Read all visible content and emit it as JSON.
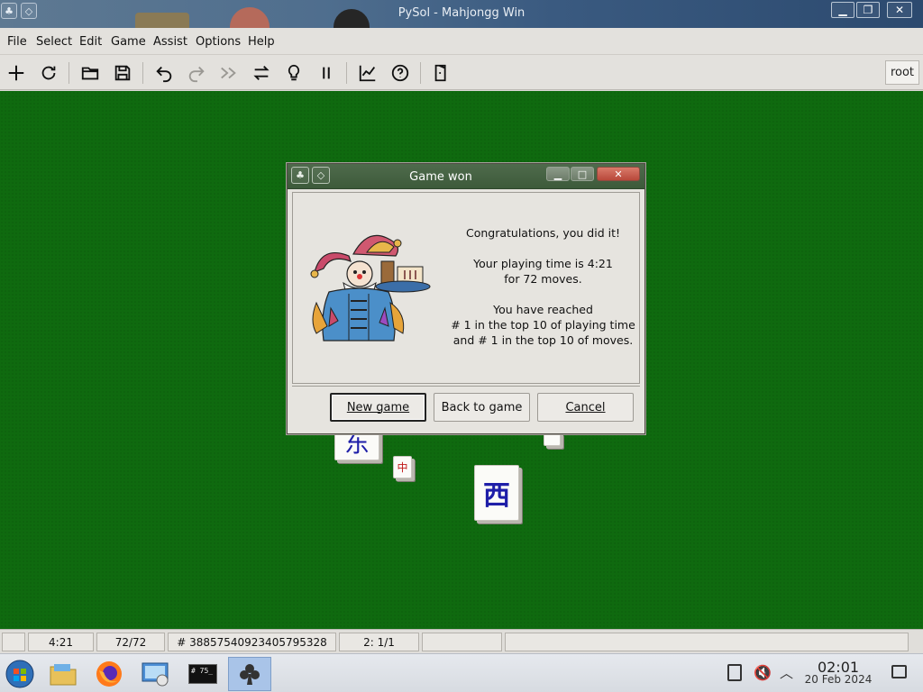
{
  "window": {
    "title": "PySol - Mahjongg Win"
  },
  "menu": {
    "items": [
      {
        "label": "File"
      },
      {
        "label": "Select"
      },
      {
        "label": "Edit"
      },
      {
        "label": "Game"
      },
      {
        "label": "Assist"
      },
      {
        "label": "Options"
      },
      {
        "label": "Help"
      }
    ]
  },
  "toolbar": {
    "icons": [
      "new-game-icon",
      "restart-icon",
      "open-icon",
      "save-icon",
      "undo-icon",
      "redo-icon",
      "autodrop-icon",
      "shuffle-icon",
      "hint-icon",
      "pause-icon",
      "statistics-icon",
      "help-icon",
      "quit-icon"
    ],
    "player": "root"
  },
  "tiles": [
    {
      "glyph": "东",
      "kind": "wind-east"
    },
    {
      "glyph": "中",
      "kind": "red-dragon"
    },
    {
      "glyph": "西",
      "kind": "wind-west"
    }
  ],
  "dialog": {
    "title": "Game won",
    "lines": [
      "Congratulations, you did it!",
      "",
      "Your playing time is 4:21",
      "for 72 moves.",
      "",
      "You have reached",
      "# 1 in the top 10 of playing time",
      "and # 1 in the top 10 of moves."
    ],
    "buttons": {
      "new_game": "New game",
      "back_to_game": "Back to game",
      "cancel": "Cancel"
    }
  },
  "status": {
    "time": "4:21",
    "moves": "72/72",
    "game_number": "# 38857540923405795328",
    "stock": "2: 1/1"
  },
  "taskbar": {
    "apps": [
      "start-orb-icon",
      "file-manager-icon",
      "firefox-icon",
      "control-panel-icon",
      "terminal-icon",
      "pysol-icon"
    ],
    "terminal_label": "# 75_",
    "clock_time": "02:01",
    "clock_date": "20 Feb 2024"
  },
  "colors": {
    "table_green": "#0f6a0f",
    "dialog_title": "#3d5a3a",
    "titlebar": "#3a5a80"
  }
}
